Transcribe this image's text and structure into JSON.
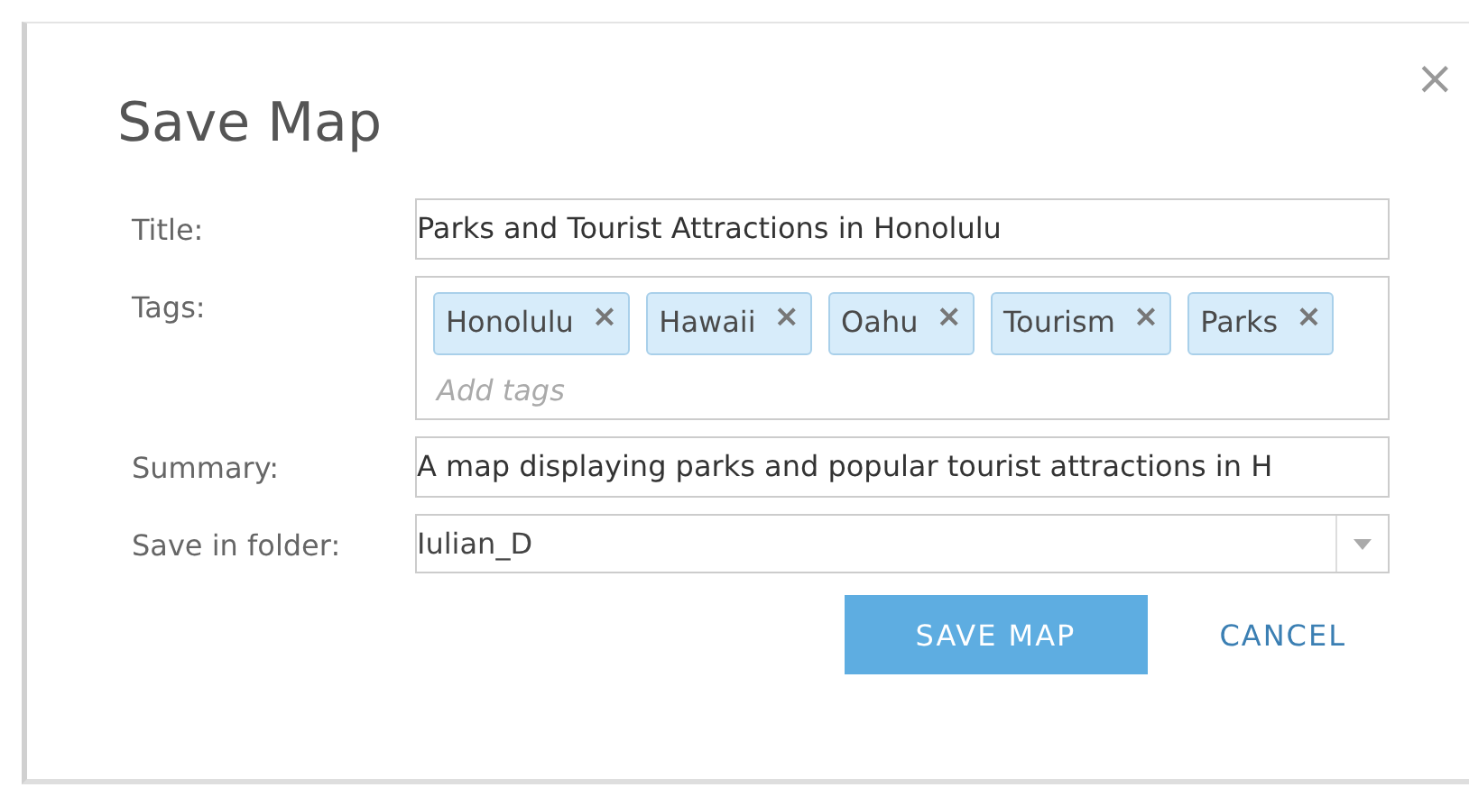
{
  "dialog": {
    "title": "Save Map",
    "close_icon": "×"
  },
  "fields": [
    {
      "kind": "text",
      "label": "Title:",
      "value": "Parks and Tourist Attractions in Honolulu"
    },
    {
      "kind": "tags",
      "label": "Tags:",
      "tags": [
        {
          "label": "Honolulu",
          "remove": "×"
        },
        {
          "label": "Hawaii",
          "remove": "×"
        },
        {
          "label": "Oahu",
          "remove": "×"
        },
        {
          "label": "Tourism",
          "remove": "×"
        },
        {
          "label": "Parks",
          "remove": "×"
        }
      ],
      "placeholder": "Add tags"
    },
    {
      "kind": "text",
      "label": "Summary:",
      "value": "A map displaying parks and popular tourist attractions in H"
    },
    {
      "kind": "select",
      "label": "Save in folder:",
      "value": "Iulian_D"
    }
  ],
  "buttons": [
    {
      "label": "SAVE MAP",
      "primary": true
    },
    {
      "label": "CANCEL",
      "primary": false
    }
  ]
}
